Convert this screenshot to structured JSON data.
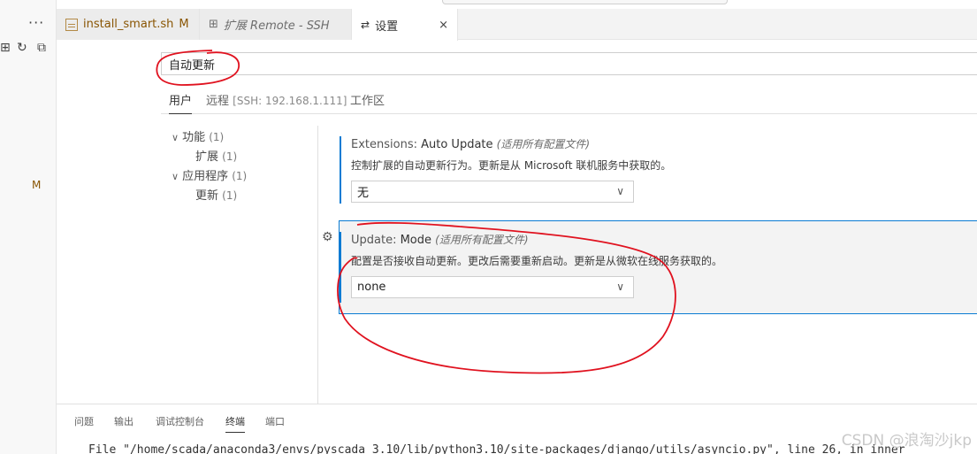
{
  "sidebar": {
    "more_icon": "···",
    "modified_marker": "M"
  },
  "tabs": [
    {
      "label": "install_smart.sh",
      "badge": "M"
    },
    {
      "label": "扩展 Remote - SSH"
    },
    {
      "label": "设置",
      "close": "×"
    }
  ],
  "search": {
    "value": "自动更新"
  },
  "scope_tabs": {
    "user": "用户",
    "remote": "远程",
    "remote_detail": "[SSH: 192.168.1.111]",
    "workspace": "工作区"
  },
  "toc": [
    {
      "label": "功能",
      "count": "(1)"
    },
    {
      "label": "扩展",
      "count": "(1)"
    },
    {
      "label": "应用程序",
      "count": "(1)"
    },
    {
      "label": "更新",
      "count": "(1)"
    }
  ],
  "settings": [
    {
      "category": "Extensions: ",
      "name": "Auto Update",
      "scope": "(适用所有配置文件)",
      "description": "控制扩展的自动更新行为。更新是从 Microsoft 联机服务中获取的。",
      "value": "无"
    },
    {
      "category": "Update: ",
      "name": "Mode",
      "scope": "(适用所有配置文件)",
      "description": "配置是否接收自动更新。更改后需要重新启动。更新是从微软在线服务获取的。",
      "value": "none"
    }
  ],
  "panel": {
    "tabs": [
      "问题",
      "输出",
      "调试控制台",
      "终端",
      "端口"
    ],
    "terminal_line": "File \"/home/scada/anaconda3/envs/pyscada_3.10/lib/python3.10/site-packages/django/utils/asyncio.py\", line 26, in inner"
  },
  "watermark": "CSDN @浪淘沙jkp",
  "colors": {
    "accent": "#0a7bd3",
    "modified": "#895503",
    "annotation": "#e0121f"
  }
}
